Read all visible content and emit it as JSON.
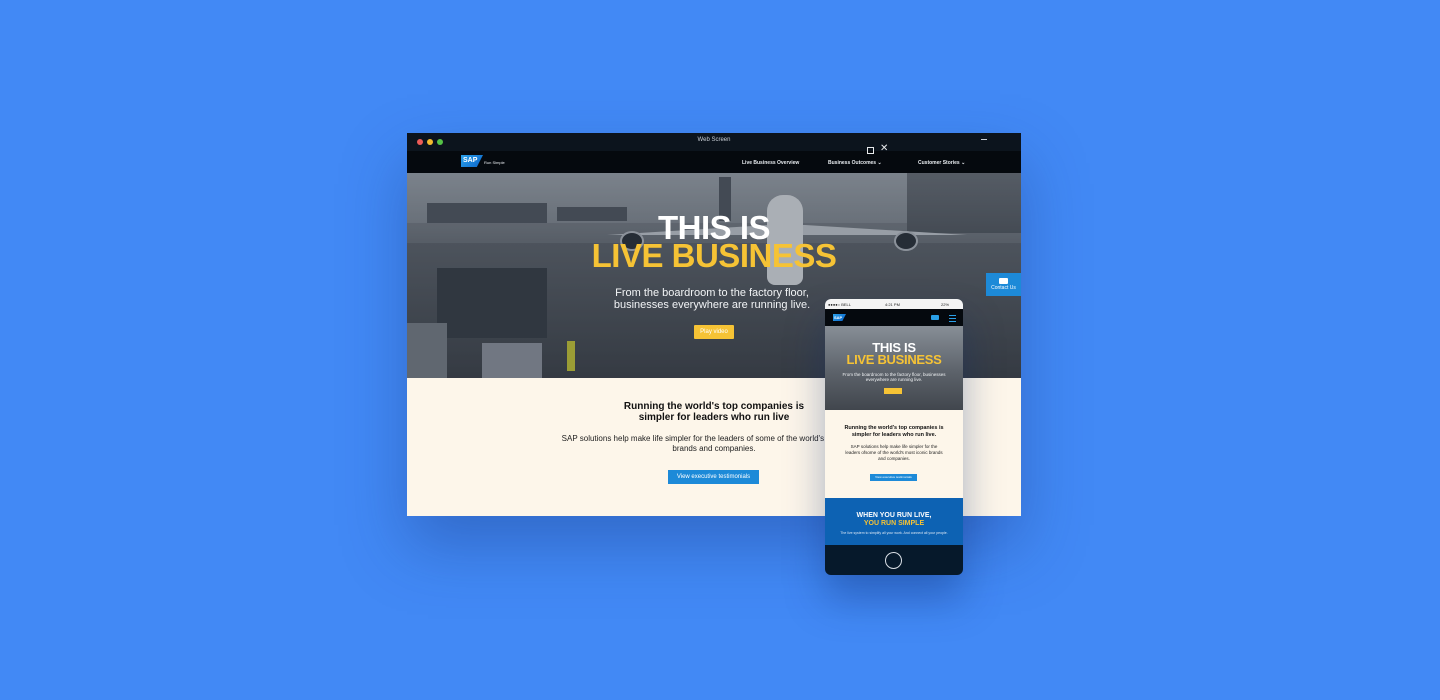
{
  "window": {
    "title": "Web Screen"
  },
  "desktop": {
    "logo": "SAP",
    "tagline": "Run Simple",
    "nav": [
      {
        "label": "Live Business Overview"
      },
      {
        "label": "Business Outcomes ⌄"
      },
      {
        "label": "Customer Stories ⌄"
      }
    ],
    "hero": {
      "line1": "THIS IS",
      "line2": "LIVE BUSINESS",
      "subtitle": "From the boardroom to the factory floor, businesses everywhere are running live.",
      "play_label": "Play video"
    },
    "contact_label": "Contact Us",
    "section": {
      "heading": "Running the world's top companies is simpler for leaders who run live",
      "body": "SAP solutions help make life simpler for the leaders of some of the world's most iconic brands and companies.",
      "button_label": "View executive testimonials"
    }
  },
  "mobile": {
    "status": {
      "carrier": "●●●●○ BELL",
      "time": "4:21 PM",
      "battery": "22%"
    },
    "logo": "SAP",
    "hero": {
      "line1": "THIS IS",
      "line2": "LIVE BUSINESS",
      "subtitle": "From the boardroom to the factory floor, businesses everywhere are running live."
    },
    "section": {
      "heading": "Running the world's top companies is simpler for leaders who run live.",
      "body": "SAP solutions help make life simpler for the leaders ofsome of the world's most iconic brands and companies.",
      "button_label": "View executive testimonials"
    },
    "banner": {
      "line1": "WHEN YOU RUN LIVE,",
      "line2": "YOU RUN SIMPLE",
      "body": "The live system to simplify all your work. And connect all your people."
    }
  },
  "colors": {
    "background": "#4289f5",
    "accent_yellow": "#f6c335",
    "accent_blue": "#1d8ad8",
    "nav_black": "#05090e"
  },
  "icons": [
    "window-close-icon",
    "window-maximize-icon",
    "window-minimize-icon",
    "chat-icon",
    "menu-icon",
    "home-button-icon"
  ]
}
